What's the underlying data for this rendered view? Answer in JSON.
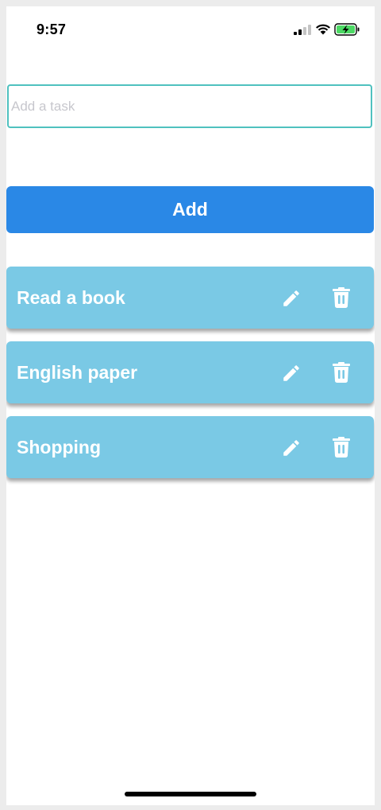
{
  "status_bar": {
    "time": "9:57",
    "icons": [
      "signal-icon",
      "wifi-icon",
      "battery-charging-icon"
    ]
  },
  "input": {
    "placeholder": "Add a task",
    "value": ""
  },
  "add_button": {
    "label": "Add"
  },
  "tasks": [
    {
      "text": "Read a book",
      "edit_icon": "pencil-icon",
      "delete_icon": "trash-icon"
    },
    {
      "text": "English paper",
      "edit_icon": "pencil-icon",
      "delete_icon": "trash-icon"
    },
    {
      "text": "Shopping",
      "edit_icon": "pencil-icon",
      "delete_icon": "trash-icon"
    }
  ],
  "colors": {
    "input_border": "#4fc1bf",
    "add_button": "#2a88e6",
    "task_card": "#7ac9e5",
    "battery_fill": "#4cd964"
  }
}
